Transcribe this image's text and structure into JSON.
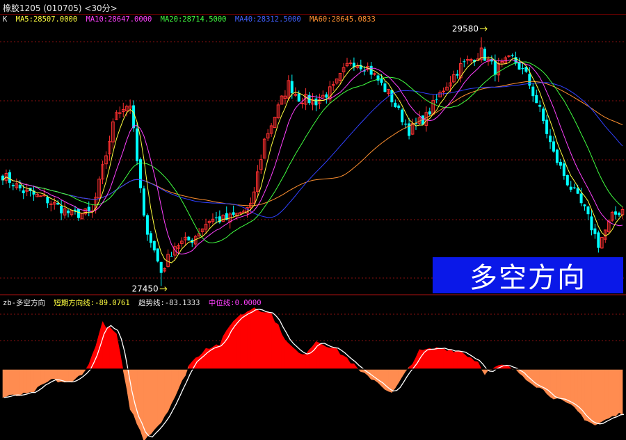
{
  "window_title": "橡胶1205 (010705) <30分>",
  "badge_text": "多空方向",
  "colors": {
    "up": "#ff3030",
    "down": "#00ffff",
    "ma5": "#ffff40",
    "ma10": "#ff40ff",
    "ma20": "#40ff40",
    "ma40": "#3040ff",
    "ma60": "#ff9030",
    "short_fill_pos": "#ff0000",
    "short_fill_neg": "#ff8c50",
    "trend_line": "#ffffff",
    "zero_line": "#ff40ff"
  },
  "chart_data": [
    {
      "type": "candlestick",
      "legend": {
        "k": "K",
        "ma5": "MA5:28507.0000",
        "ma10": "MA10:28647.0000",
        "ma20": "MA20:28714.5000",
        "ma40": "MA40:28312.5000",
        "ma60": "MA60:28645.0833"
      },
      "ylim": [
        27400,
        29720
      ],
      "annotations": {
        "high_label": "29580",
        "high_value": 29580,
        "low_label": "27450",
        "low_value": 27450
      },
      "close_anchors": [
        [
          0,
          28400
        ],
        [
          6,
          28260
        ],
        [
          12,
          28200
        ],
        [
          20,
          28060
        ],
        [
          26,
          28080
        ],
        [
          33,
          28950
        ],
        [
          37,
          29010
        ],
        [
          41,
          28020
        ],
        [
          46,
          27570
        ],
        [
          50,
          27800
        ],
        [
          55,
          27850
        ],
        [
          60,
          28020
        ],
        [
          65,
          28020
        ],
        [
          72,
          28120
        ],
        [
          76,
          28700
        ],
        [
          83,
          29180
        ],
        [
          86,
          29060
        ],
        [
          91,
          29030
        ],
        [
          96,
          29140
        ],
        [
          101,
          29380
        ],
        [
          106,
          29320
        ],
        [
          112,
          29100
        ],
        [
          118,
          28780
        ],
        [
          123,
          28900
        ],
        [
          128,
          29140
        ],
        [
          133,
          29330
        ],
        [
          139,
          29450
        ],
        [
          143,
          29300
        ],
        [
          148,
          29400
        ],
        [
          152,
          29250
        ],
        [
          156,
          28950
        ],
        [
          160,
          28580
        ],
        [
          164,
          28340
        ],
        [
          169,
          28100
        ],
        [
          173,
          27810
        ],
        [
          177,
          28040
        ],
        [
          180,
          28110
        ]
      ]
    },
    {
      "type": "area",
      "legend": {
        "name": "zb-多空方向",
        "short": "短期方向线:-89.0761",
        "trend": "趋势线:-83.1333",
        "zero": "中位线:0.0000"
      },
      "ylim": [
        -100,
        90
      ],
      "short_anchors": [
        [
          0,
          -40
        ],
        [
          8,
          -35
        ],
        [
          14,
          -15
        ],
        [
          20,
          -20
        ],
        [
          25,
          5
        ],
        [
          29,
          65
        ],
        [
          33,
          50
        ],
        [
          35,
          -5
        ],
        [
          37,
          -55
        ],
        [
          41,
          -100
        ],
        [
          46,
          -75
        ],
        [
          51,
          -30
        ],
        [
          54,
          5
        ],
        [
          59,
          30
        ],
        [
          63,
          35
        ],
        [
          67,
          70
        ],
        [
          73,
          88
        ],
        [
          78,
          78
        ],
        [
          83,
          35
        ],
        [
          87,
          18
        ],
        [
          91,
          40
        ],
        [
          96,
          30
        ],
        [
          100,
          15
        ],
        [
          104,
          -5
        ],
        [
          108,
          -15
        ],
        [
          113,
          -35
        ],
        [
          117,
          -5
        ],
        [
          121,
          25
        ],
        [
          127,
          30
        ],
        [
          133,
          25
        ],
        [
          138,
          10
        ],
        [
          140,
          -5
        ],
        [
          145,
          5
        ],
        [
          148,
          0
        ],
        [
          150,
          -5
        ],
        [
          154,
          -20
        ],
        [
          160,
          -40
        ],
        [
          166,
          -55
        ],
        [
          169,
          -70
        ],
        [
          172,
          -80
        ],
        [
          176,
          -70
        ],
        [
          180,
          -62
        ]
      ]
    }
  ]
}
